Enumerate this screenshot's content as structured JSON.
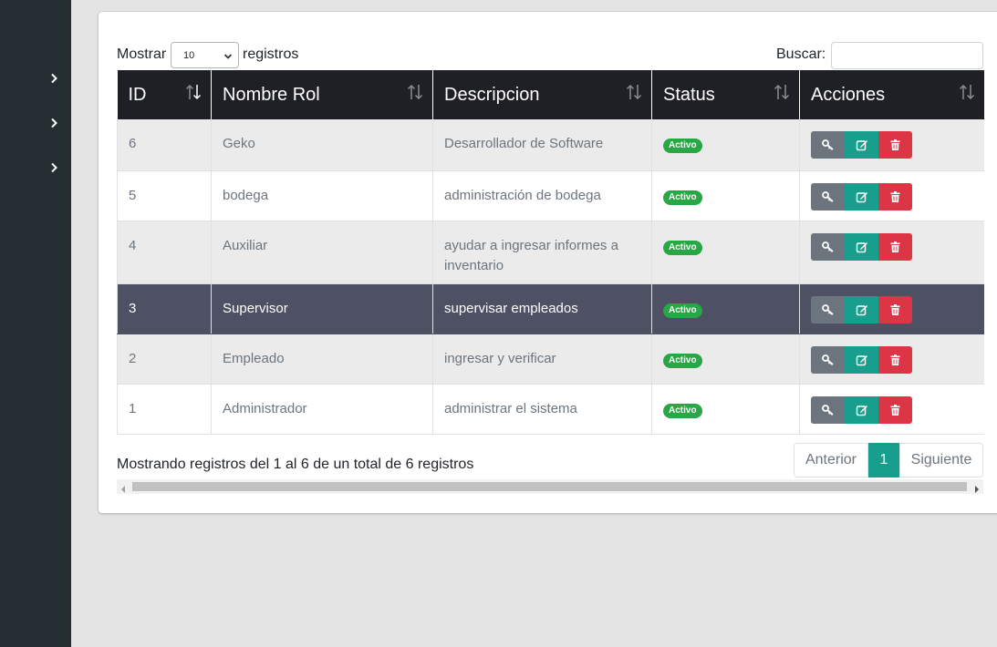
{
  "sidebar": {
    "items": [
      {
        "icon": "chevron-right-icon"
      },
      {
        "icon": "chevron-right-icon"
      },
      {
        "icon": "chevron-right-icon"
      }
    ]
  },
  "controls": {
    "show_label": "Mostrar",
    "page_length": "10",
    "show_suffix": "registros",
    "search_label": "Buscar:",
    "search_value": ""
  },
  "table": {
    "headers": {
      "id": "ID",
      "name": "Nombre Rol",
      "description": "Descripcion",
      "status": "Status",
      "actions": "Acciones"
    },
    "rows": [
      {
        "id": "6",
        "name": "Geko",
        "description": "Desarrollador de Software",
        "status": "Activo"
      },
      {
        "id": "5",
        "name": "bodega",
        "description": "administración de bodega",
        "status": "Activo"
      },
      {
        "id": "4",
        "name": "Auxiliar",
        "description": "ayudar a ingresar informes a inventario",
        "status": "Activo"
      },
      {
        "id": "3",
        "name": "Supervisor",
        "description": "supervisar empleados",
        "status": "Activo"
      },
      {
        "id": "2",
        "name": "Empleado",
        "description": "ingresar y verificar",
        "status": "Activo"
      },
      {
        "id": "1",
        "name": "Administrador",
        "description": "administrar el sistema",
        "status": "Activo"
      }
    ],
    "selected_row_id": "3"
  },
  "footer": {
    "info": "Mostrando registros del 1 al 6 de un total de 6 registros",
    "prev_label": "Anterior",
    "current_page": "1",
    "next_label": "Siguiente"
  },
  "colors": {
    "sidebar": "#242e33",
    "header": "#1f2026",
    "selected_row": "#4e5064",
    "badge": "#28a745",
    "edit_button": "#179e8d",
    "delete_button": "#dc3545",
    "key_button": "#6c757d"
  }
}
